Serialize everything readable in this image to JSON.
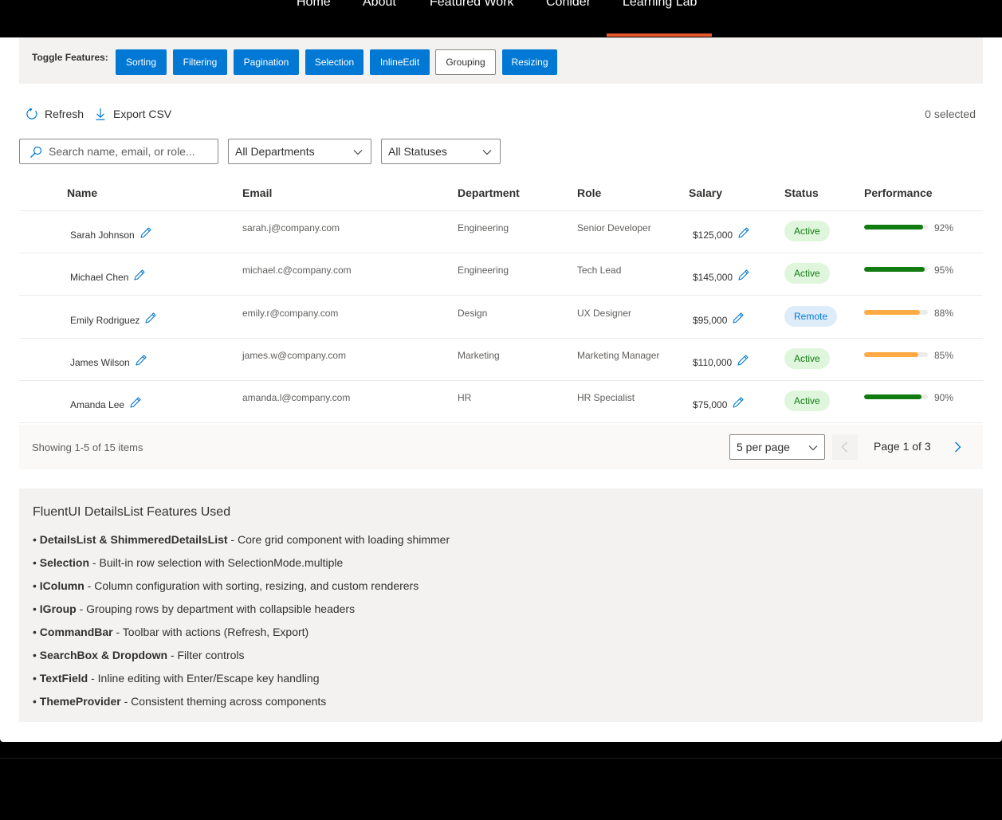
{
  "nav": {
    "items": [
      {
        "label": "Home"
      },
      {
        "label": "About"
      },
      {
        "label": "Featured Work"
      },
      {
        "label": "Conlder"
      },
      {
        "label": "Learning Lab"
      }
    ],
    "active": "Learning Lab",
    "accent_color": "#e8572a"
  },
  "features_bar": {
    "label": "Toggle Features:",
    "buttons": [
      {
        "label": "Sorting",
        "on": true
      },
      {
        "label": "Filtering",
        "on": true
      },
      {
        "label": "Pagination",
        "on": true
      },
      {
        "label": "Selection",
        "on": true
      },
      {
        "label": "InlineEdit",
        "on": true
      },
      {
        "label": "Grouping",
        "on": false
      },
      {
        "label": "Resizing",
        "on": true
      }
    ],
    "on_color": "#0078d4"
  },
  "commandbar": {
    "refresh_label": "Refresh",
    "export_label": "Export CSV",
    "selected_text": "0 selected"
  },
  "filters": {
    "search_placeholder": "Search name, email, or role...",
    "department": "All Departments",
    "status": "All Statuses"
  },
  "table": {
    "columns": [
      "Name",
      "Email",
      "Department",
      "Role",
      "Salary",
      "Status",
      "Performance"
    ],
    "rows": [
      {
        "name": "Sarah Johnson",
        "email": "sarah.j@company.com",
        "department": "Engineering",
        "role": "Senior Developer",
        "salary": "$125,000",
        "status": "Active",
        "performance": 92,
        "performance_label": "92%",
        "bar_color": "#107c10"
      },
      {
        "name": "Michael Chen",
        "email": "michael.c@company.com",
        "department": "Engineering",
        "role": "Tech Lead",
        "salary": "$145,000",
        "status": "Active",
        "performance": 95,
        "performance_label": "95%",
        "bar_color": "#107c10"
      },
      {
        "name": "Emily Rodriguez",
        "email": "emily.r@company.com",
        "department": "Design",
        "role": "UX Designer",
        "salary": "$95,000",
        "status": "Remote",
        "performance": 88,
        "performance_label": "88%",
        "bar_color": "#ffaa44"
      },
      {
        "name": "James Wilson",
        "email": "james.w@company.com",
        "department": "Marketing",
        "role": "Marketing Manager",
        "salary": "$110,000",
        "status": "Active",
        "performance": 85,
        "performance_label": "85%",
        "bar_color": "#ffaa44"
      },
      {
        "name": "Amanda Lee",
        "email": "amanda.l@company.com",
        "department": "HR",
        "role": "HR Specialist",
        "salary": "$75,000",
        "status": "Active",
        "performance": 90,
        "performance_label": "90%",
        "bar_color": "#107c10"
      }
    ]
  },
  "pagination": {
    "showing": "Showing 1-5 of 15 items",
    "per_page": "5 per page",
    "page_info": "Page 1 of 3"
  },
  "features_info": {
    "title": "FluentUI DetailsList Features Used",
    "items": [
      {
        "bold": "DetailsList & ShimmeredDetailsList",
        "text": " - Core grid component with loading shimmer"
      },
      {
        "bold": "Selection",
        "text": " - Built-in row selection with SelectionMode.multiple"
      },
      {
        "bold": "IColumn",
        "text": " - Column configuration with sorting, resizing, and custom renderers"
      },
      {
        "bold": "IGroup",
        "text": " - Grouping rows by department with collapsible headers"
      },
      {
        "bold": "CommandBar",
        "text": " - Toolbar with actions (Refresh, Export)"
      },
      {
        "bold": "SearchBox & Dropdown",
        "text": " - Filter controls"
      },
      {
        "bold": "TextField",
        "text": " - Inline editing with Enter/Escape key handling"
      },
      {
        "bold": "ThemeProvider",
        "text": " - Consistent theming across components"
      }
    ]
  }
}
